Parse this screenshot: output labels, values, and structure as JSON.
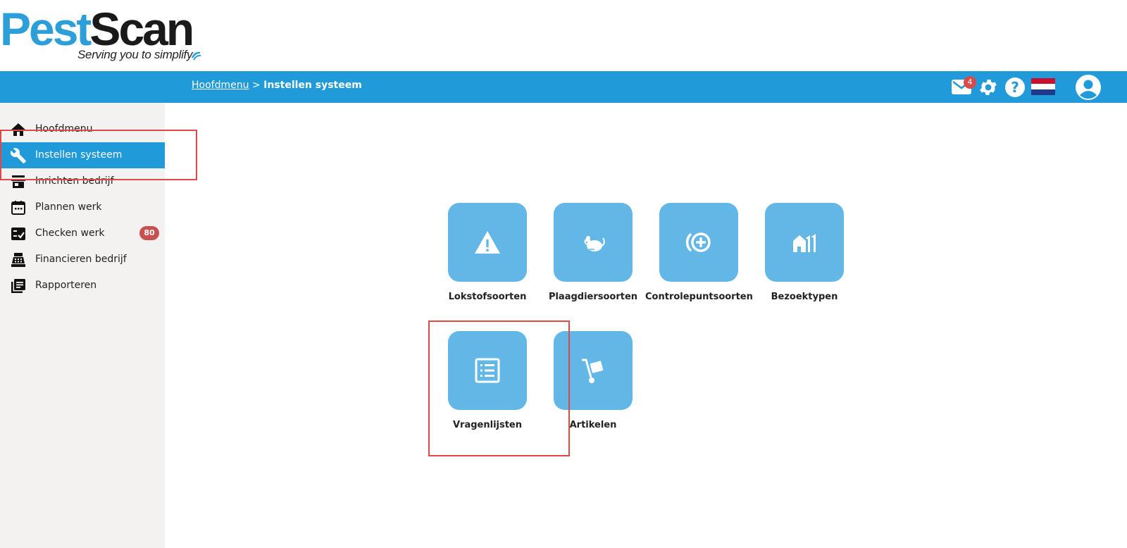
{
  "brand": {
    "name_part1": "Pest",
    "name_part2": "Scan",
    "tagline": "Serving you to simplify"
  },
  "header": {
    "breadcrumb_link": "Hoofdmenu",
    "breadcrumb_separator": " > ",
    "breadcrumb_current": "Instellen systeem",
    "mail_count": "4"
  },
  "sidebar": {
    "items": [
      {
        "label": "Hoofdmenu",
        "icon": "home-icon"
      },
      {
        "label": "Instellen systeem",
        "icon": "wrench-icon"
      },
      {
        "label": "Inrichten bedrijf",
        "icon": "store-icon"
      },
      {
        "label": "Plannen werk",
        "icon": "calendar-icon"
      },
      {
        "label": "Checken werk",
        "icon": "checklist-icon",
        "badge": "80"
      },
      {
        "label": "Financieren bedrijf",
        "icon": "cash-register-icon"
      },
      {
        "label": "Rapporteren",
        "icon": "report-icon"
      }
    ]
  },
  "tiles": [
    {
      "label": "Lokstofsoorten",
      "icon": "warning-icon"
    },
    {
      "label": "Plaagdiersoorten",
      "icon": "mouse-icon"
    },
    {
      "label": "Controlepuntsoorten",
      "icon": "control-point-icon"
    },
    {
      "label": "Bezoektypen",
      "icon": "houses-icon"
    },
    {
      "label": "Vragenlijsten",
      "icon": "list-icon"
    },
    {
      "label": "Artikelen",
      "icon": "hand-truck-icon"
    }
  ],
  "colors": {
    "primary": "#209ad9",
    "tile": "#63b7e6",
    "sidebar_bg": "#f3f2f0",
    "badge": "#c85050",
    "highlight": "#e04848"
  }
}
